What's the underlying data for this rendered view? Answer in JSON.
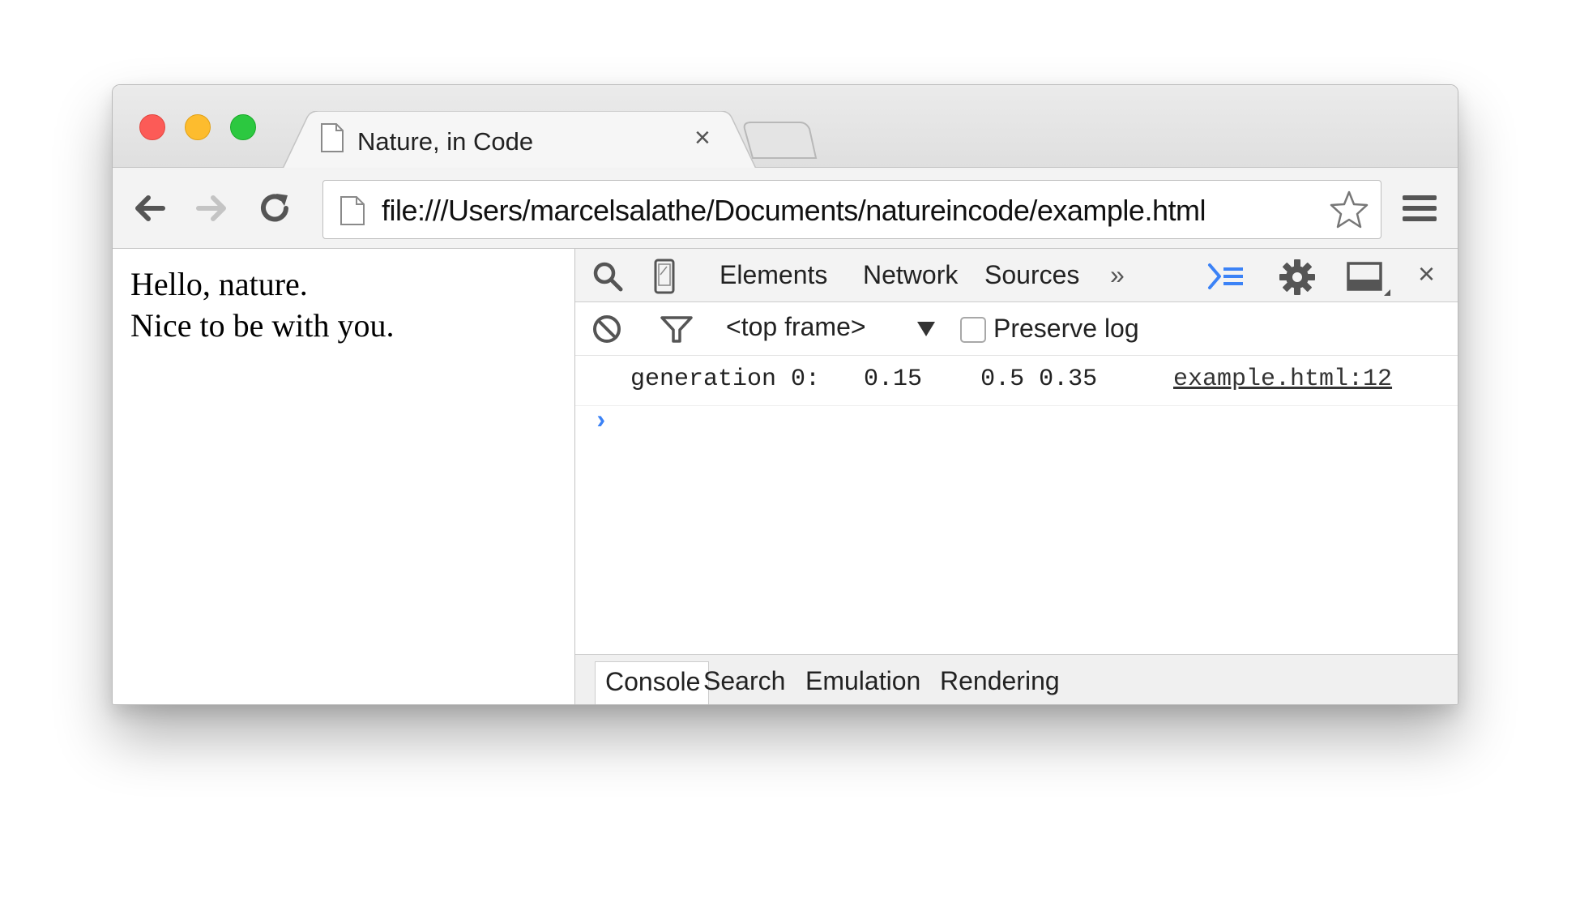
{
  "browser": {
    "tab": {
      "title": "Nature, in Code",
      "close_glyph": "×"
    },
    "url": "file:///Users/marcelsalathe/Documents/natureincode/example.html"
  },
  "page": {
    "lines": [
      "Hello, nature.",
      "Nice to be with you."
    ]
  },
  "devtools": {
    "tabs": [
      "Elements",
      "Network",
      "Sources"
    ],
    "more_glyph": "»",
    "close_glyph": "×",
    "frame_selector": "<top frame>",
    "preserve_log_label": "Preserve log",
    "preserve_log_checked": false,
    "console": {
      "message": "generation 0:   0.15    0.5 0.35",
      "source": "example.html:12",
      "prompt": "›"
    },
    "drawer_tabs": [
      "Console",
      "Search",
      "Emulation",
      "Rendering"
    ],
    "active_drawer_tab": "Console",
    "accent_color": "#3b82f6"
  },
  "colors": {
    "close": "#fc5b57",
    "minimize": "#fdbc2e",
    "maximize": "#2cc840"
  }
}
